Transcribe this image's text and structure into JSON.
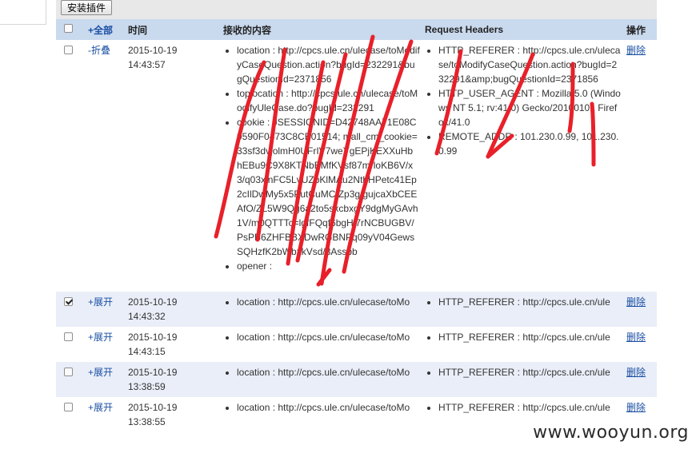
{
  "toolbar": {
    "install_label": "安装插件"
  },
  "header": {
    "select_all": "+全部",
    "time": "时间",
    "content": "接收的内容",
    "headers": "Request Headers",
    "action": "操作"
  },
  "expanded_row": {
    "toggle": "-折叠",
    "date": "2015-10-19",
    "time": "14:43:57",
    "checked": false,
    "content": [
      "location : http://cpcs.ule.cn/ulecase/toModifyCaseQuestion.action?bugId=232291&bugQuestionId=2371856",
      "toplocation : http://cpcs.ule.cn/ulecase/toModifyUleCase.do?bugId=232291",
      "cookie : JSESSIONID=D42748AA71E08C9590F0473C8CB01514; mall_cm_cookie=33sf3dvjolmH0UFrIV7weYgEPjKEXXuHb hEBu9C9X8KTNbBMfKVsf87mrloKB6V/x3/q03xlnFC5LvUZbKlMAu2NtbHPetc41Ep2cIlDwMy5x5PutCuMC/Zp3g/gujcaXbCEEAfO/ZL5W9Qg6a2to5sxcbxgY9dgMyGAvh1V/m0QTTTc=lgfFQqf6bgHi7rNCBUGBV/PsPB6ZHFBBXDwRGBNPq09yV04GewsSQHzfK2bWbxkVsd/8Assbb",
      "opener :"
    ],
    "headers": [
      "HTTP_REFERER : http://cpcs.ule.cn/ulecase/toModifyCaseQuestion.action?bugId=232291&amp;bugQuestionId=2371856",
      "HTTP_USER_AGENT : Mozilla/5.0 (Windows NT 5.1; rv:41.0) Gecko/20100101 Firefox/41.0",
      "REMOTE_ADDR : 101.230.0.99, 101.230.0.99"
    ],
    "delete": "删除"
  },
  "rows": [
    {
      "toggle": "+展开",
      "date": "2015-10-19",
      "time": "14:43:32",
      "checked": true,
      "content": "location : http://cpcs.ule.cn/ulecase/toMo",
      "headers": "HTTP_REFERER : http://cpcs.ule.cn/ule",
      "delete": "删除"
    },
    {
      "toggle": "+展开",
      "date": "2015-10-19",
      "time": "14:43:15",
      "checked": false,
      "content": "location : http://cpcs.ule.cn/ulecase/toMo",
      "headers": "HTTP_REFERER : http://cpcs.ule.cn/ule",
      "delete": "删除"
    },
    {
      "toggle": "+展开",
      "date": "2015-10-19",
      "time": "13:38:59",
      "checked": false,
      "content": "location : http://cpcs.ule.cn/ulecase/toMo",
      "headers": "HTTP_REFERER : http://cpcs.ule.cn/ule",
      "delete": "删除"
    },
    {
      "toggle": "+展开",
      "date": "2015-10-19",
      "time": "13:38:55",
      "checked": false,
      "content": "location : http://cpcs.ule.cn/ulecase/toMo",
      "headers": "HTTP_REFERER : http://cpcs.ule.cn/ule",
      "delete": "删除"
    }
  ],
  "watermark": "www.wooyun.org",
  "colors": {
    "header_bg": "#c9d9ee",
    "alt_row": "#e9eef8",
    "link": "#1a4fa3",
    "scribble": "#e8202a"
  }
}
